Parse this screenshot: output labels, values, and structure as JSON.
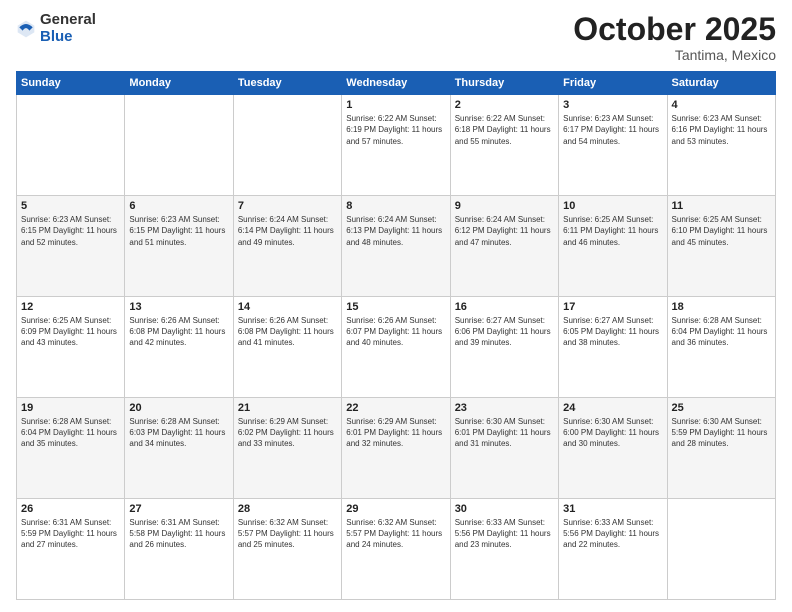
{
  "header": {
    "logo_general": "General",
    "logo_blue": "Blue",
    "month": "October 2025",
    "location": "Tantima, Mexico"
  },
  "days_of_week": [
    "Sunday",
    "Monday",
    "Tuesday",
    "Wednesday",
    "Thursday",
    "Friday",
    "Saturday"
  ],
  "weeks": [
    [
      {
        "day": "",
        "info": ""
      },
      {
        "day": "",
        "info": ""
      },
      {
        "day": "",
        "info": ""
      },
      {
        "day": "1",
        "info": "Sunrise: 6:22 AM\nSunset: 6:19 PM\nDaylight: 11 hours\nand 57 minutes."
      },
      {
        "day": "2",
        "info": "Sunrise: 6:22 AM\nSunset: 6:18 PM\nDaylight: 11 hours\nand 55 minutes."
      },
      {
        "day": "3",
        "info": "Sunrise: 6:23 AM\nSunset: 6:17 PM\nDaylight: 11 hours\nand 54 minutes."
      },
      {
        "day": "4",
        "info": "Sunrise: 6:23 AM\nSunset: 6:16 PM\nDaylight: 11 hours\nand 53 minutes."
      }
    ],
    [
      {
        "day": "5",
        "info": "Sunrise: 6:23 AM\nSunset: 6:15 PM\nDaylight: 11 hours\nand 52 minutes."
      },
      {
        "day": "6",
        "info": "Sunrise: 6:23 AM\nSunset: 6:15 PM\nDaylight: 11 hours\nand 51 minutes."
      },
      {
        "day": "7",
        "info": "Sunrise: 6:24 AM\nSunset: 6:14 PM\nDaylight: 11 hours\nand 49 minutes."
      },
      {
        "day": "8",
        "info": "Sunrise: 6:24 AM\nSunset: 6:13 PM\nDaylight: 11 hours\nand 48 minutes."
      },
      {
        "day": "9",
        "info": "Sunrise: 6:24 AM\nSunset: 6:12 PM\nDaylight: 11 hours\nand 47 minutes."
      },
      {
        "day": "10",
        "info": "Sunrise: 6:25 AM\nSunset: 6:11 PM\nDaylight: 11 hours\nand 46 minutes."
      },
      {
        "day": "11",
        "info": "Sunrise: 6:25 AM\nSunset: 6:10 PM\nDaylight: 11 hours\nand 45 minutes."
      }
    ],
    [
      {
        "day": "12",
        "info": "Sunrise: 6:25 AM\nSunset: 6:09 PM\nDaylight: 11 hours\nand 43 minutes."
      },
      {
        "day": "13",
        "info": "Sunrise: 6:26 AM\nSunset: 6:08 PM\nDaylight: 11 hours\nand 42 minutes."
      },
      {
        "day": "14",
        "info": "Sunrise: 6:26 AM\nSunset: 6:08 PM\nDaylight: 11 hours\nand 41 minutes."
      },
      {
        "day": "15",
        "info": "Sunrise: 6:26 AM\nSunset: 6:07 PM\nDaylight: 11 hours\nand 40 minutes."
      },
      {
        "day": "16",
        "info": "Sunrise: 6:27 AM\nSunset: 6:06 PM\nDaylight: 11 hours\nand 39 minutes."
      },
      {
        "day": "17",
        "info": "Sunrise: 6:27 AM\nSunset: 6:05 PM\nDaylight: 11 hours\nand 38 minutes."
      },
      {
        "day": "18",
        "info": "Sunrise: 6:28 AM\nSunset: 6:04 PM\nDaylight: 11 hours\nand 36 minutes."
      }
    ],
    [
      {
        "day": "19",
        "info": "Sunrise: 6:28 AM\nSunset: 6:04 PM\nDaylight: 11 hours\nand 35 minutes."
      },
      {
        "day": "20",
        "info": "Sunrise: 6:28 AM\nSunset: 6:03 PM\nDaylight: 11 hours\nand 34 minutes."
      },
      {
        "day": "21",
        "info": "Sunrise: 6:29 AM\nSunset: 6:02 PM\nDaylight: 11 hours\nand 33 minutes."
      },
      {
        "day": "22",
        "info": "Sunrise: 6:29 AM\nSunset: 6:01 PM\nDaylight: 11 hours\nand 32 minutes."
      },
      {
        "day": "23",
        "info": "Sunrise: 6:30 AM\nSunset: 6:01 PM\nDaylight: 11 hours\nand 31 minutes."
      },
      {
        "day": "24",
        "info": "Sunrise: 6:30 AM\nSunset: 6:00 PM\nDaylight: 11 hours\nand 30 minutes."
      },
      {
        "day": "25",
        "info": "Sunrise: 6:30 AM\nSunset: 5:59 PM\nDaylight: 11 hours\nand 28 minutes."
      }
    ],
    [
      {
        "day": "26",
        "info": "Sunrise: 6:31 AM\nSunset: 5:59 PM\nDaylight: 11 hours\nand 27 minutes."
      },
      {
        "day": "27",
        "info": "Sunrise: 6:31 AM\nSunset: 5:58 PM\nDaylight: 11 hours\nand 26 minutes."
      },
      {
        "day": "28",
        "info": "Sunrise: 6:32 AM\nSunset: 5:57 PM\nDaylight: 11 hours\nand 25 minutes."
      },
      {
        "day": "29",
        "info": "Sunrise: 6:32 AM\nSunset: 5:57 PM\nDaylight: 11 hours\nand 24 minutes."
      },
      {
        "day": "30",
        "info": "Sunrise: 6:33 AM\nSunset: 5:56 PM\nDaylight: 11 hours\nand 23 minutes."
      },
      {
        "day": "31",
        "info": "Sunrise: 6:33 AM\nSunset: 5:56 PM\nDaylight: 11 hours\nand 22 minutes."
      },
      {
        "day": "",
        "info": ""
      }
    ]
  ]
}
